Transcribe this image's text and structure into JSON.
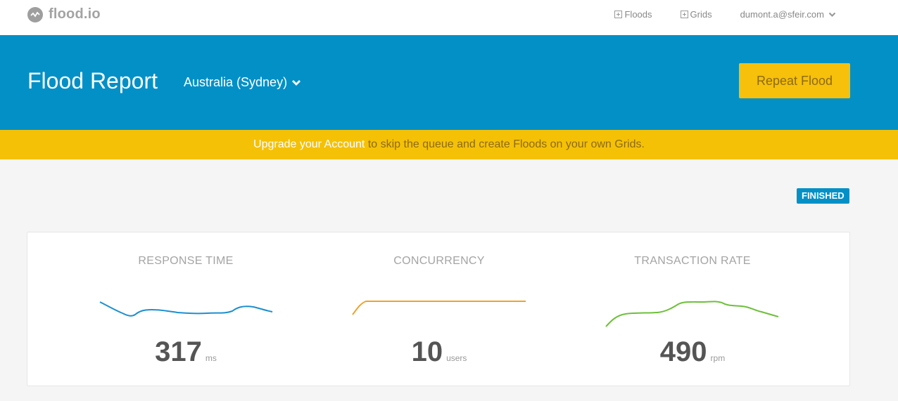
{
  "nav": {
    "logo_text": "flood.io",
    "links": [
      {
        "label": "Floods"
      },
      {
        "label": "Grids"
      }
    ],
    "user_email": "dumont.a@sfeir.com"
  },
  "header": {
    "title": "Flood Report",
    "region": "Australia (Sydney)",
    "repeat_button": "Repeat Flood"
  },
  "banner": {
    "link_text": "Upgrade your Account",
    "text": " to skip the queue and create Floods on your own Grids."
  },
  "status": "FINISHED",
  "metrics": [
    {
      "title": "RESPONSE TIME",
      "value": "317",
      "unit": "ms",
      "color": "#1c8fd0"
    },
    {
      "title": "CONCURRENCY",
      "value": "10",
      "unit": "users",
      "color": "#f0a22b"
    },
    {
      "title": "TRANSACTION RATE",
      "value": "490",
      "unit": "rpm",
      "color": "#6dc039"
    }
  ],
  "colors": {
    "primary": "#0390c7",
    "accent": "#f5c106"
  }
}
